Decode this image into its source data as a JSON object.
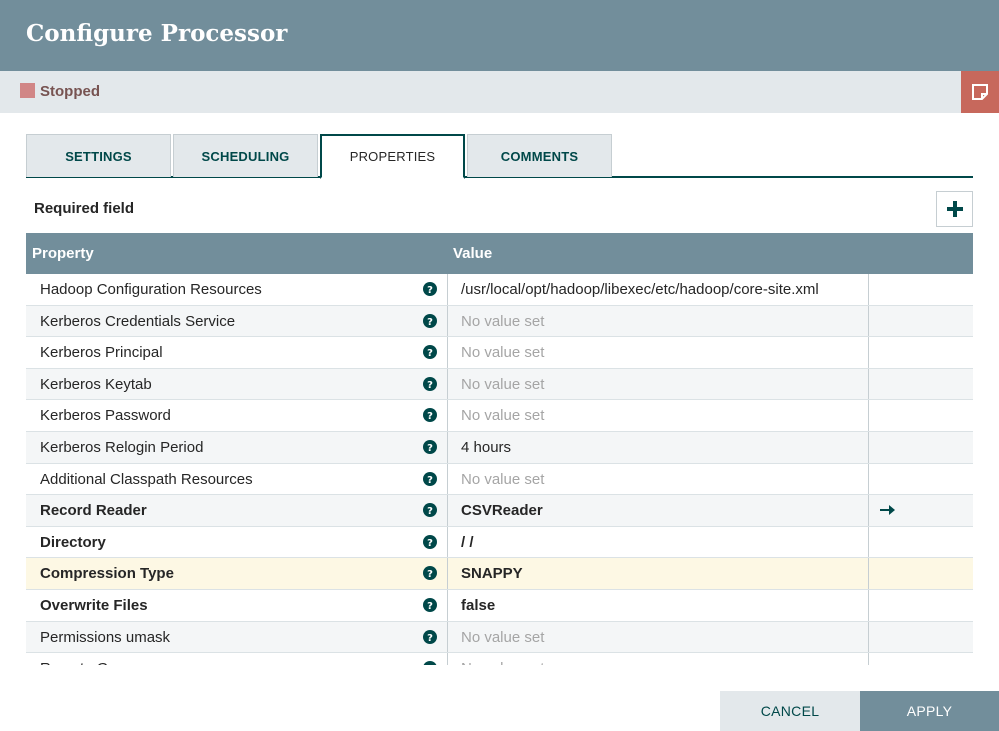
{
  "dialog": {
    "title": "Configure Processor"
  },
  "status": {
    "text": "Stopped",
    "color": "#d18686"
  },
  "tabs": [
    {
      "label": "SETTINGS",
      "active": false
    },
    {
      "label": "SCHEDULING",
      "active": false
    },
    {
      "label": "PROPERTIES",
      "active": true
    },
    {
      "label": "COMMENTS",
      "active": false
    }
  ],
  "properties": {
    "required_label": "Required field",
    "columns": {
      "property": "Property",
      "value": "Value"
    },
    "rows": [
      {
        "name": "Hadoop Configuration Resources",
        "value": "/usr/local/opt/hadoop/libexec/etc/hadoop/core-site.xml",
        "required": false,
        "unset": false
      },
      {
        "name": "Kerberos Credentials Service",
        "value": "No value set",
        "required": false,
        "unset": true
      },
      {
        "name": "Kerberos Principal",
        "value": "No value set",
        "required": false,
        "unset": true
      },
      {
        "name": "Kerberos Keytab",
        "value": "No value set",
        "required": false,
        "unset": true
      },
      {
        "name": "Kerberos Password",
        "value": "No value set",
        "required": false,
        "unset": true
      },
      {
        "name": "Kerberos Relogin Period",
        "value": "4 hours",
        "required": false,
        "unset": false
      },
      {
        "name": "Additional Classpath Resources",
        "value": "No value set",
        "required": false,
        "unset": true
      },
      {
        "name": "Record Reader",
        "value": "CSVReader",
        "required": true,
        "unset": false
      },
      {
        "name": "Directory",
        "value": "/                                                          /",
        "required": true,
        "unset": false
      },
      {
        "name": "Compression Type",
        "value": "SNAPPY",
        "required": true,
        "unset": false
      },
      {
        "name": "Overwrite Files",
        "value": "false",
        "required": true,
        "unset": false
      },
      {
        "name": "Permissions umask",
        "value": "No value set",
        "required": false,
        "unset": true
      },
      {
        "name": "Remote Group",
        "value": "No value set",
        "required": false,
        "unset": true
      }
    ]
  },
  "buttons": {
    "cancel": "CANCEL",
    "apply": "APPLY"
  },
  "icons": {
    "help": "help-circle-icon",
    "add": "plus-icon",
    "goto": "arrow-right-icon",
    "note": "sticky-note-icon"
  },
  "colors": {
    "header": "#728e9b",
    "accent": "#004849",
    "stopped": "#d18686",
    "highlight": "#fdf8e4"
  }
}
